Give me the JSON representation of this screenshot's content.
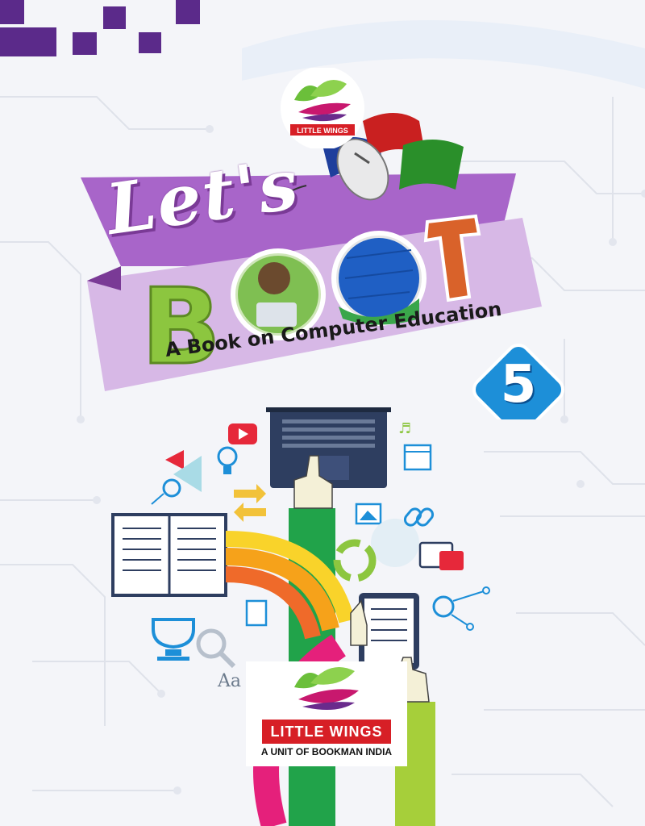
{
  "series": {
    "title_part1": "Let's",
    "title_part2": "BOOT"
  },
  "subtitle": "A Book on Computer Education",
  "grade": "5",
  "top_logo": {
    "text": "LITTLE WINGS"
  },
  "publisher": {
    "name": "LITTLE WINGS",
    "tagline": "A UNIT OF BOOKMAN INDIA"
  },
  "icons": {
    "font_glyph": "Aa"
  },
  "colors": {
    "banner_purple": "#a865c9",
    "banner_light": "#d7b8e6",
    "letter_green": "#8cc63f",
    "letter_orange": "#e0662a",
    "badge_blue": "#1d8fd8",
    "brand_red": "#d71f26",
    "sleeve_green": "#21a34a"
  }
}
